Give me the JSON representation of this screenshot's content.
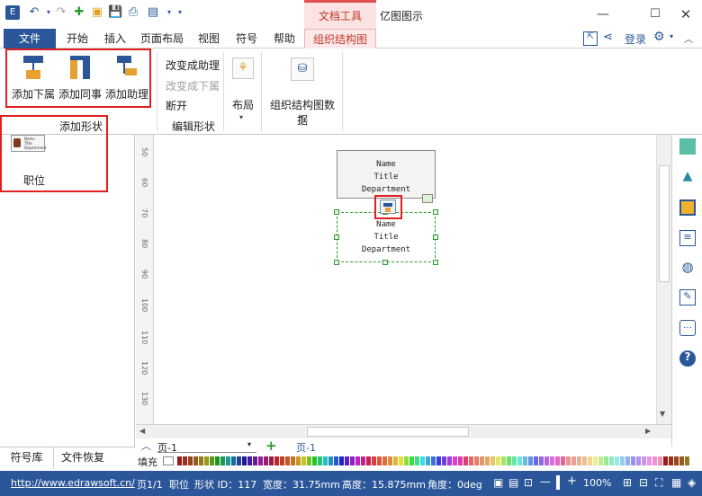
{
  "title_bar": {
    "context_label": "文档工具",
    "app_title": "亿图图示",
    "window_controls": [
      "minimize-icon",
      "restore-icon",
      "close-icon"
    ]
  },
  "menu": {
    "file": "文件",
    "items": [
      "开始",
      "插入",
      "页面布局",
      "视图",
      "符号",
      "帮助"
    ],
    "active_tab": "组织结构图",
    "login": "登录"
  },
  "ribbon": {
    "add_group": {
      "buttons": [
        "添加下属",
        "添加同事",
        "添加助理"
      ],
      "group_label": "添加形状"
    },
    "edit_group": {
      "items": [
        "改变成助理",
        "改变成下属",
        "断开"
      ],
      "group_label": "编辑形状"
    },
    "layout_label": "布局",
    "orgdata_label": "组织结构图数据"
  },
  "left_panel": {
    "shape_label": "职位",
    "thumb_lines": [
      "Name",
      "Title",
      "Department"
    ]
  },
  "ruler_ticks": [
    "50",
    "60",
    "70",
    "80",
    "90",
    "100",
    "110",
    "120",
    "130"
  ],
  "shapes": {
    "top_card": [
      "Name",
      "Title",
      "Department"
    ],
    "selected_card": [
      "Name",
      "Title",
      "Department"
    ]
  },
  "bottom_tabs": [
    "符号库",
    "文件恢复"
  ],
  "page_bar": {
    "page_select": "页-1",
    "page_tab": "页-1",
    "fill_label": "填充"
  },
  "status": {
    "url": "http://www.edrawsoft.cn/",
    "page": "页1/1",
    "shape_name": "职位",
    "shape_id": "形状 ID：117",
    "width": "宽度：31.75mm",
    "height": "高度：15.875mm",
    "angle": "角度：0deg",
    "zoom": "100%"
  },
  "colors": {
    "brand": "#2b579a",
    "highlight": "#e02020",
    "selection": "#2e9a2e"
  }
}
